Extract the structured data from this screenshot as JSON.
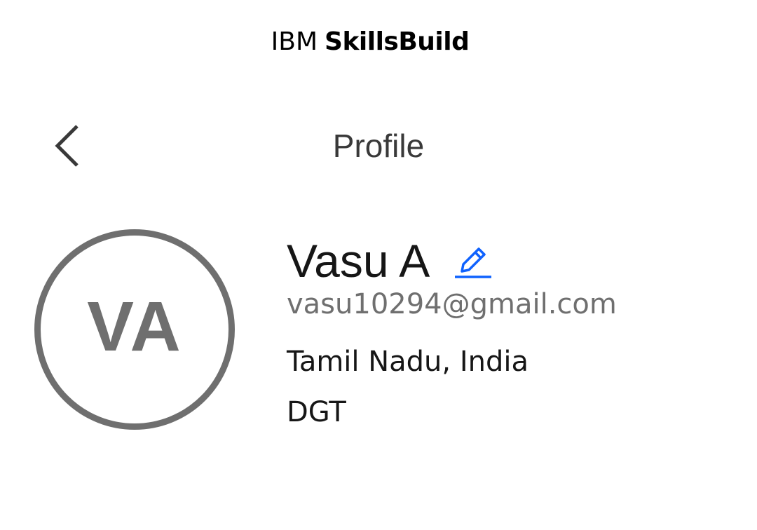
{
  "header": {
    "brand_prefix": "IBM",
    "brand_product": "SkillsBuild"
  },
  "nav": {
    "back_icon": "chevron-left-icon",
    "title": "Profile"
  },
  "profile": {
    "initials": "VA",
    "name": "Vasu A",
    "edit_icon": "pencil-edit-icon",
    "email": "vasu10294@gmail.com",
    "location": "Tamil Nadu, India",
    "organization": "DGT"
  },
  "colors": {
    "text_primary": "#161616",
    "text_secondary": "#6f6f6f",
    "title": "#393939",
    "avatar": "#6f6f6f",
    "accent": "#0f62fe",
    "background": "#ffffff"
  }
}
